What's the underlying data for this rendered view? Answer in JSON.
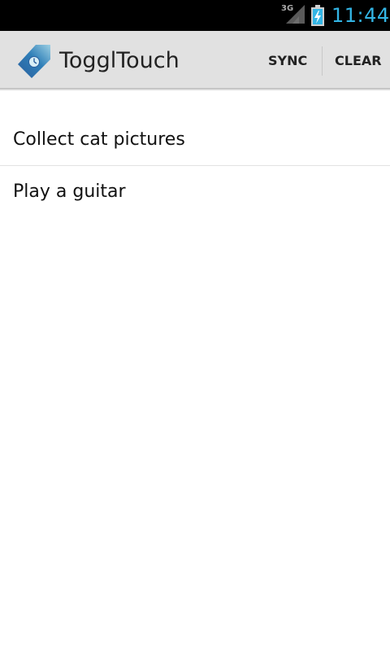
{
  "status_bar": {
    "network": "3G",
    "time": "11:44",
    "battery_icon": "battery-charging-icon",
    "signal_icon": "signal-icon"
  },
  "action_bar": {
    "title": "TogglTouch",
    "app_icon": "toggl-clock-tag-icon",
    "sync_label": "SYNC",
    "clear_label": "CLEAR"
  },
  "tasks": [
    {
      "label": "Collect cat pictures"
    },
    {
      "label": "Play a guitar"
    }
  ],
  "colors": {
    "status_bar_bg": "#000000",
    "time_color": "#33b5e5",
    "action_bar_bg": "#e1e1e1",
    "background": "#ffffff"
  }
}
